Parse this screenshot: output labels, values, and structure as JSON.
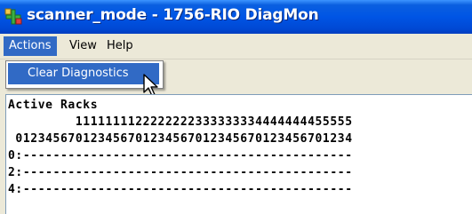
{
  "window": {
    "title": "scanner_mode - 1756-RIO DiagMon",
    "icon": "network-app-icon"
  },
  "menubar": {
    "items": [
      {
        "label": "Actions",
        "active": true
      },
      {
        "label": "View",
        "active": false
      },
      {
        "label": "Help",
        "active": false
      }
    ]
  },
  "actions_menu": {
    "items": [
      {
        "label": "Clear Diagnostics",
        "highlighted": true
      }
    ]
  },
  "content": {
    "heading": "Active Racks",
    "header_tens": "         1111111122222222333333334444444455555",
    "header_ones": " 012345670123456701234567012345670123456701234",
    "rows": [
      {
        "label": "0:",
        "value": "--------------------------------------------"
      },
      {
        "label": "2:",
        "value": "--------------------------------------------"
      },
      {
        "label": "4:",
        "value": "--------------------------------------------"
      }
    ]
  },
  "colors": {
    "titlebar": "#0055e5",
    "menu_highlight": "#316ac5",
    "background": "#ece9d8"
  }
}
